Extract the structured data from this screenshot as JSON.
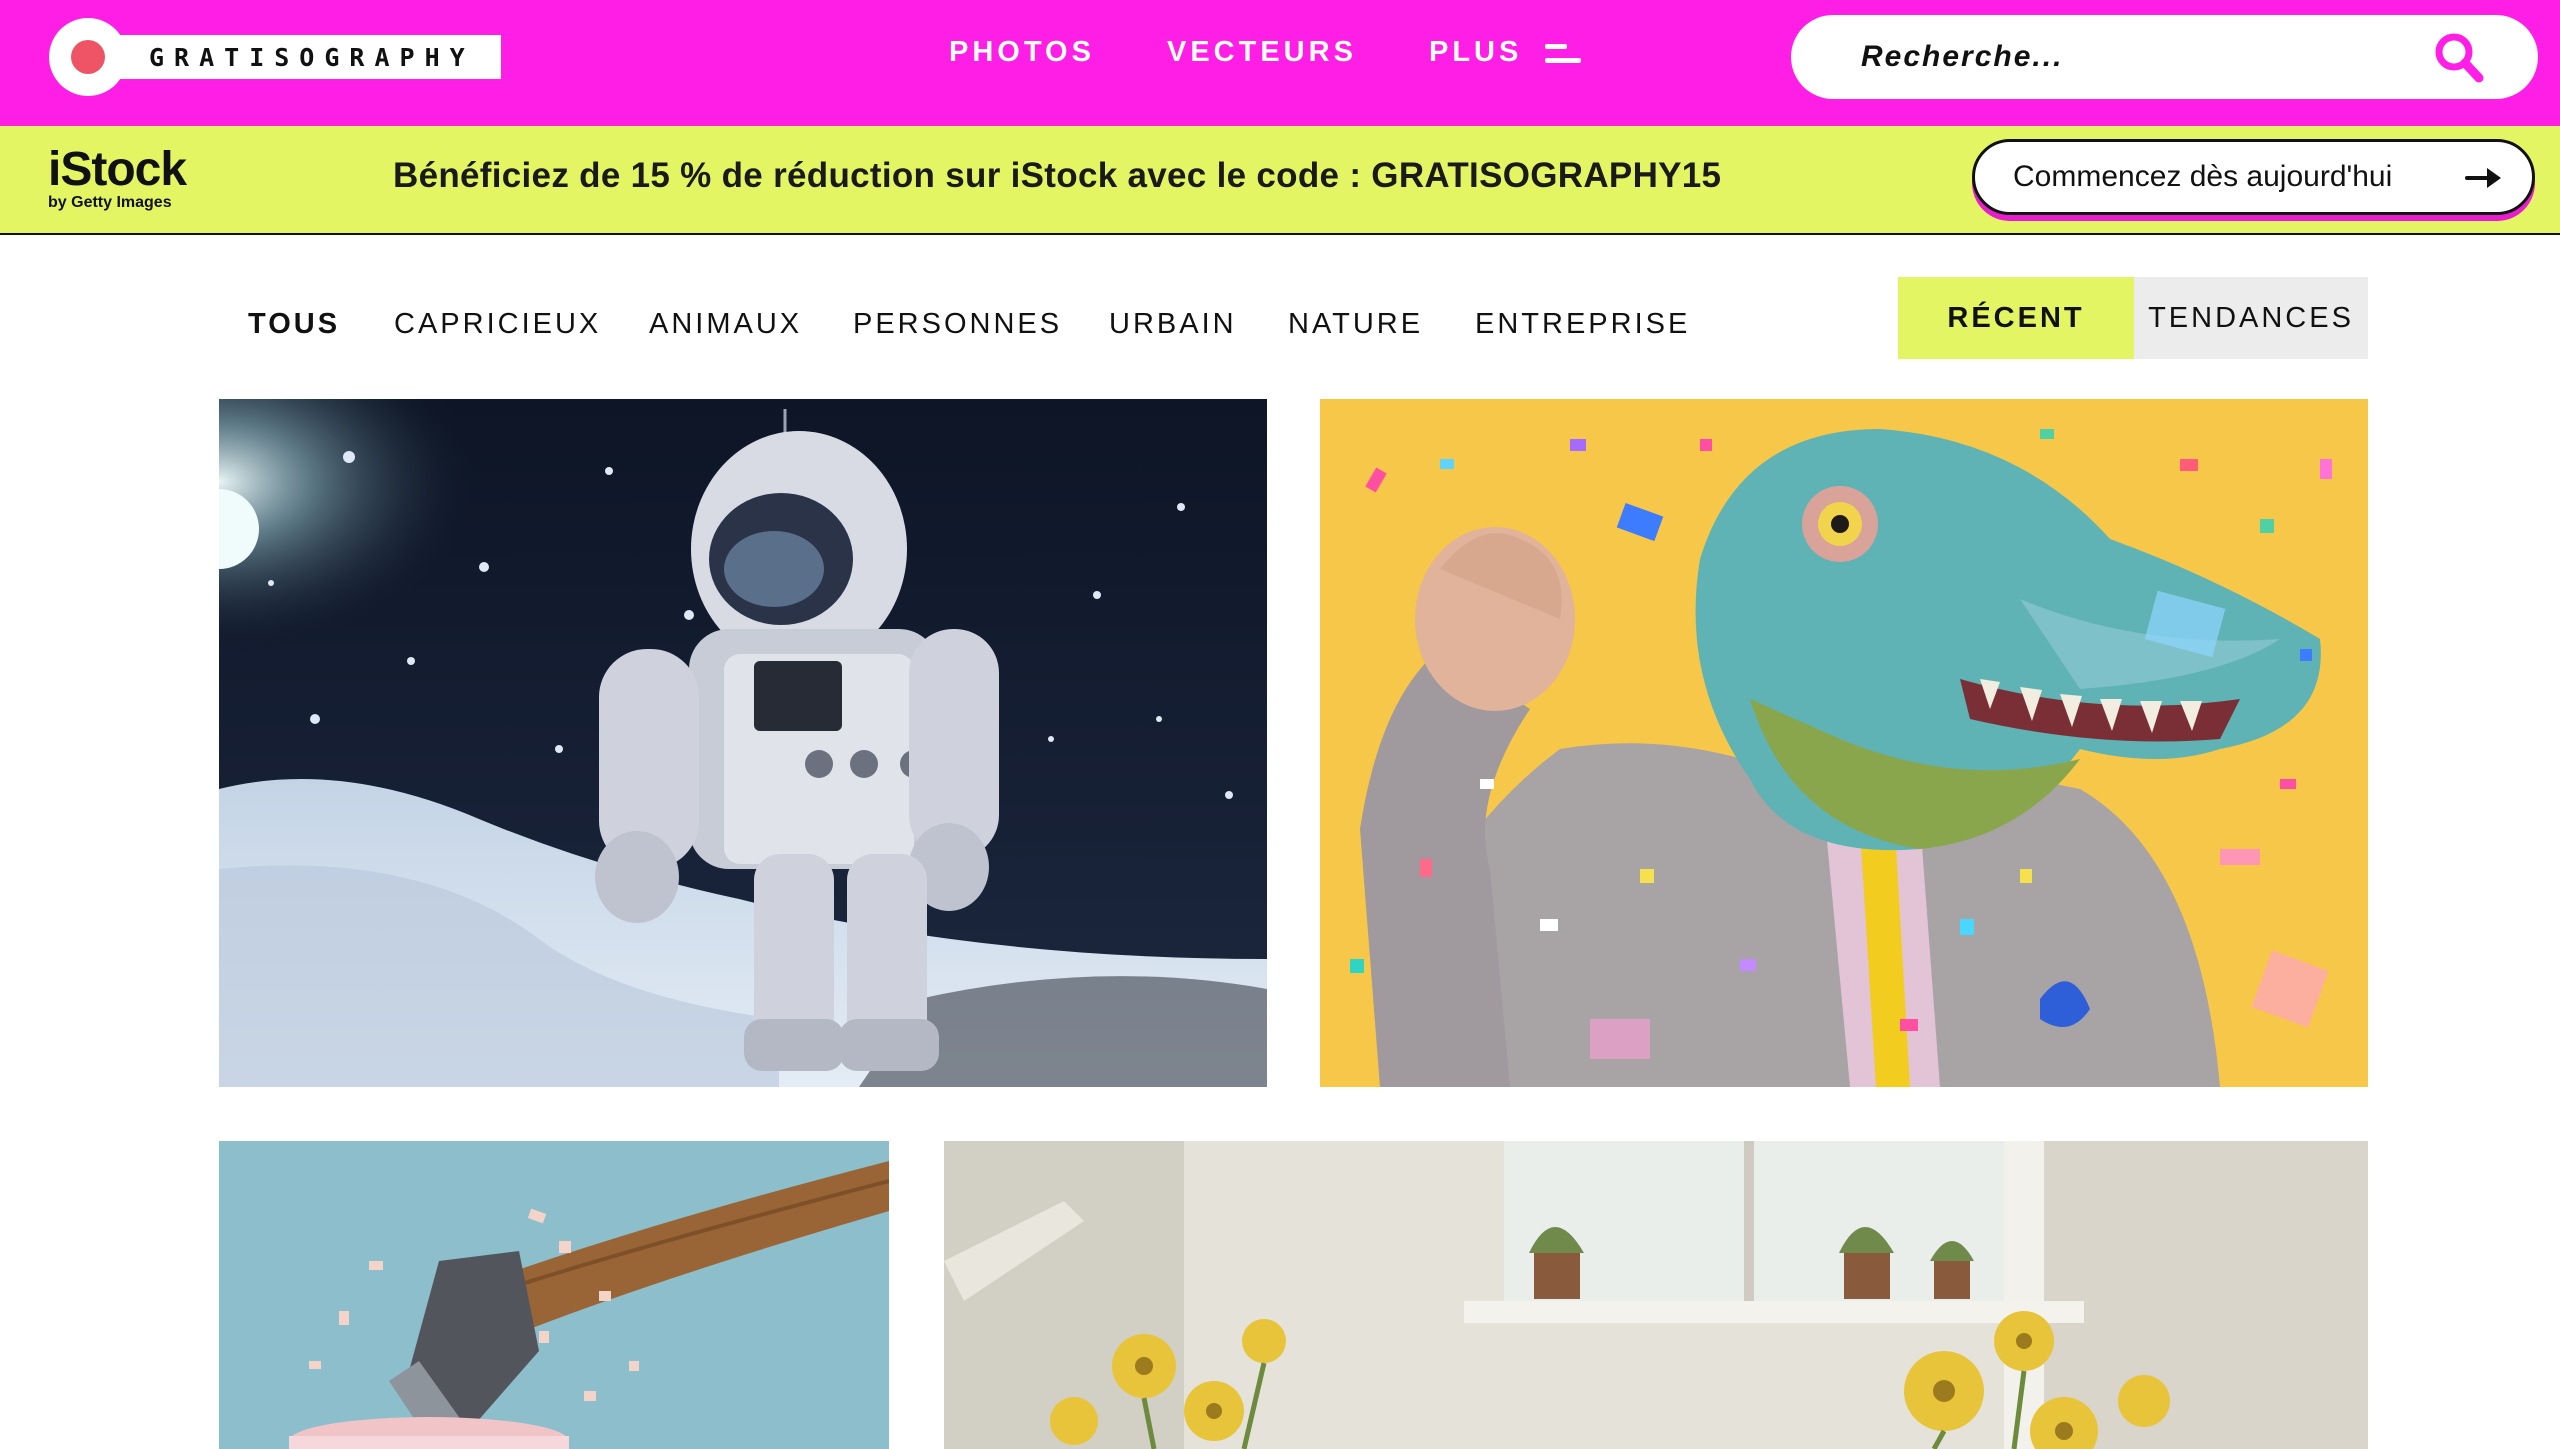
{
  "header": {
    "logo_text": "GRATISOGRAPHY",
    "nav": {
      "photos": "PHOTOS",
      "vectors": "VECTEURS",
      "more": "PLUS"
    },
    "search_placeholder": "Recherche..."
  },
  "promo": {
    "brand": "iStock",
    "brand_sub": "by Getty Images",
    "text": "Bénéficiez de 15 % de réduction sur iStock avec le code : GRATISOGRAPHY15",
    "button_label": "Commencez dès aujourd'hui"
  },
  "filters": {
    "categories": [
      "TOUS",
      "CAPRICIEUX",
      "ANIMAUX",
      "PERSONNES",
      "URBAIN",
      "NATURE",
      "ENTREPRISE"
    ],
    "active_category": "TOUS",
    "sort": {
      "recent": "RÉCENT",
      "trending": "TENDANCES",
      "active": "RÉCENT"
    }
  },
  "photos": [
    {
      "subject": "astronaut-on-moon"
    },
    {
      "subject": "dinosaur-mask-man-confetti"
    },
    {
      "subject": "axe-cake"
    },
    {
      "subject": "flowers-window"
    }
  ],
  "colors": {
    "brand_pink": "#ff1ee6",
    "promo_yellow": "#e4f564",
    "logo_dot": "#ef5466",
    "sort_inactive": "#ececec"
  },
  "icons": [
    "search-icon",
    "menu-lines-icon",
    "arrow-right-icon"
  ]
}
